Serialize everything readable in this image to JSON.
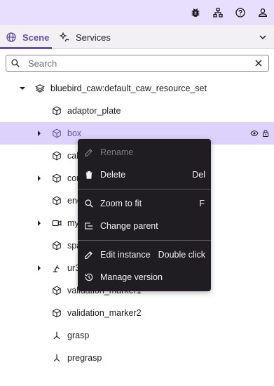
{
  "topbar": {
    "icons": [
      "bug-icon",
      "hierarchy-icon",
      "help-icon",
      "account-icon"
    ]
  },
  "tabs": [
    {
      "label": "Scene",
      "icon": "globe-icon",
      "active": true
    },
    {
      "label": "Services",
      "icon": "services-icon",
      "active": false
    }
  ],
  "search": {
    "placeholder": "Search",
    "value": ""
  },
  "tree": {
    "root": {
      "label": "bluebird_caw:default_caw_resource_set",
      "icon": "layers-icon"
    },
    "items": [
      {
        "label": "adaptor_plate",
        "icon": "cube-icon",
        "expandable": false
      },
      {
        "label": "box",
        "icon": "cube-icon",
        "expandable": true,
        "selected": true
      },
      {
        "label": "cal",
        "icon": "cube-icon",
        "expandable": false
      },
      {
        "label": "con",
        "icon": "cube-icon",
        "expandable": true
      },
      {
        "label": "end",
        "icon": "cube-icon",
        "expandable": false
      },
      {
        "label": "my",
        "icon": "camera-icon",
        "expandable": true
      },
      {
        "label": "spa",
        "icon": "cube-icon",
        "expandable": false
      },
      {
        "label": "ur3",
        "icon": "robot-arm-icon",
        "expandable": true
      },
      {
        "label": "validation_marker1",
        "icon": "cube-icon",
        "expandable": false
      },
      {
        "label": "validation_marker2",
        "icon": "cube-icon",
        "expandable": false
      },
      {
        "label": "grasp",
        "icon": "frame-icon",
        "expandable": false
      },
      {
        "label": "pregrasp",
        "icon": "frame-icon",
        "expandable": false
      }
    ]
  },
  "context_menu": {
    "items": [
      {
        "label": "Rename",
        "shortcut": "",
        "icon": "pencil-icon",
        "disabled": true
      },
      {
        "label": "Delete",
        "shortcut": "Del",
        "icon": "trash-icon",
        "disabled": false
      },
      {
        "label": "Zoom to fit",
        "shortcut": "F",
        "icon": "search-icon",
        "disabled": false
      },
      {
        "label": "Change parent",
        "shortcut": "",
        "icon": "reparent-icon",
        "disabled": false
      },
      {
        "label": "Edit instance",
        "shortcut": "Double click",
        "icon": "pencil-icon",
        "disabled": false
      },
      {
        "label": "Manage version",
        "shortcut": "",
        "icon": "history-icon",
        "disabled": false
      }
    ]
  },
  "colors": {
    "accent": "#6750a4",
    "topbar_bg": "#e8defe",
    "selected_row": "#ddd2fb",
    "menu_bg": "#1f1d22"
  }
}
